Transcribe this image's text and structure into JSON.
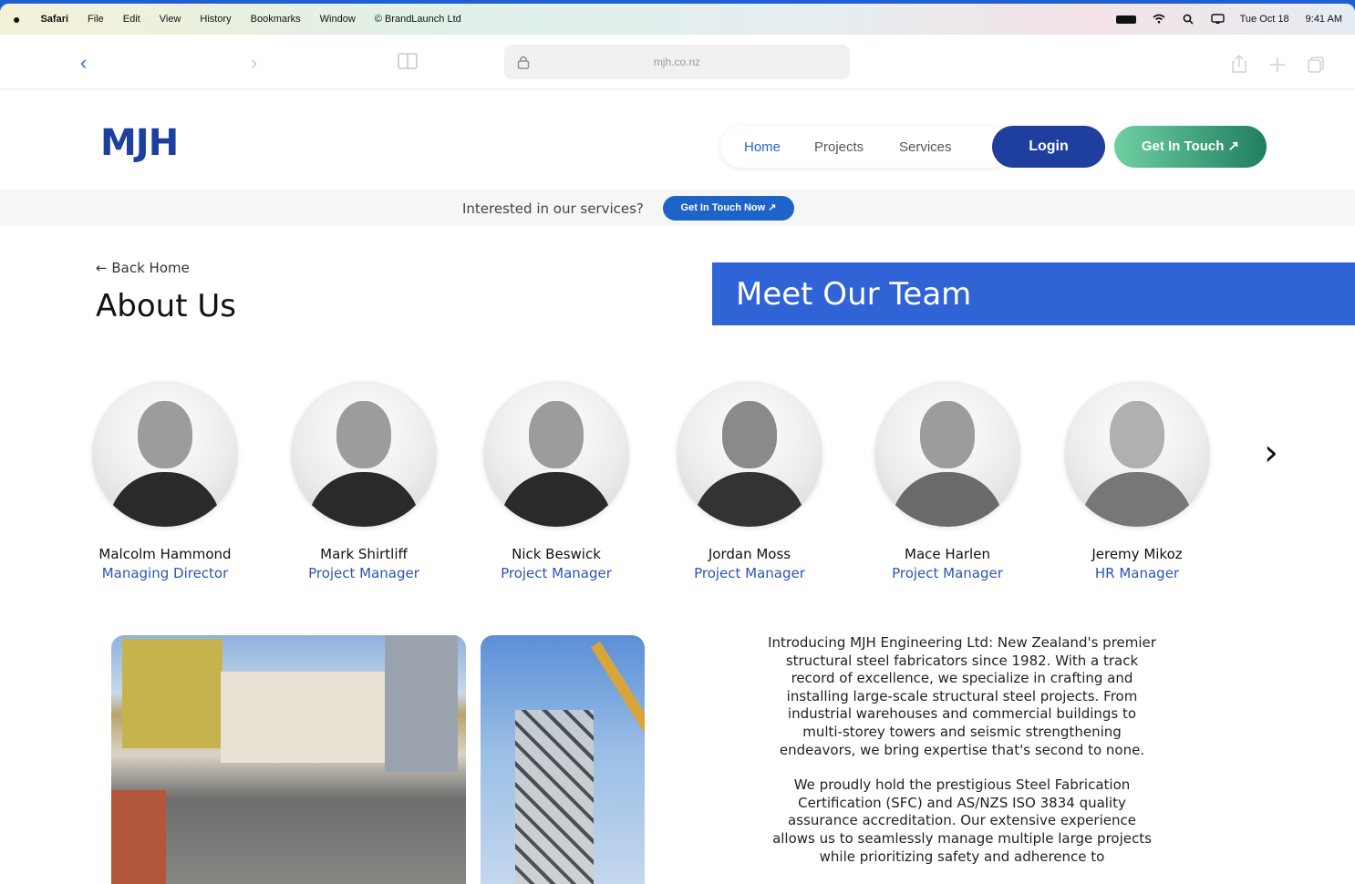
{
  "menubar": {
    "items": [
      "Safari",
      "File",
      "Edit",
      "View",
      "History",
      "Bookmarks",
      "Window",
      "© BrandLaunch Ltd"
    ],
    "date": "Tue Oct 18",
    "time": "9:41 AM"
  },
  "toolbar": {
    "url": "mjh.co.nz"
  },
  "header": {
    "logo": "MJH",
    "nav": [
      "Home",
      "Projects",
      "Services"
    ],
    "login_label": "Login",
    "touch_label": "Get In Touch ↗"
  },
  "banner": {
    "text": "Interested in our services?",
    "button": "Get In Touch Now ↗"
  },
  "about": {
    "back_label": "Back Home",
    "title": "About Us",
    "team_title": "Meet Our Team"
  },
  "team": [
    {
      "name": "Malcolm Hammond",
      "role": "Managing Director"
    },
    {
      "name": "Mark Shirtliff",
      "role": "Project Manager"
    },
    {
      "name": "Nick Beswick",
      "role": "Project Manager"
    },
    {
      "name": "Jordan Moss",
      "role": "Project Manager"
    },
    {
      "name": "Mace Harlen",
      "role": "Project Manager"
    },
    {
      "name": "Jeremy Mikoz",
      "role": "HR Manager"
    }
  ],
  "intro": {
    "p1": "Introducing MJH Engineering Ltd: New Zealand's premier structural steel fabricators since 1982. With a track record of excellence, we specialize in crafting and installing large-scale structural steel projects. From industrial warehouses and commercial buildings to multi-storey towers and seismic strengthening endeavors, we bring expertise that's second to none.",
    "p2": "We proudly hold the prestigious Steel Fabrication Certification (SFC) and AS/NZS ISO 3834 quality assurance accreditation. Our extensive experience allows us to seamlessly manage multiple large projects while prioritizing safety and adherence to"
  },
  "colors": {
    "brand_blue": "#1f3f9f",
    "accent_blue": "#2f63d6",
    "green_start": "#6fcfa3",
    "green_end": "#1f7f5f"
  }
}
